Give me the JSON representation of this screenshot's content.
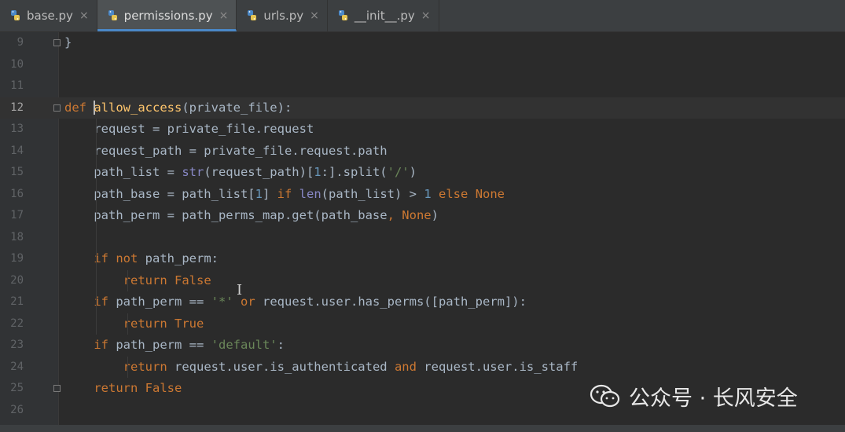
{
  "tabs": [
    {
      "label": "base.py",
      "icon": "python-file-icon",
      "active": false
    },
    {
      "label": "permissions.py",
      "icon": "python-file-icon",
      "active": true
    },
    {
      "label": "urls.py",
      "icon": "python-file-icon",
      "active": false
    },
    {
      "label": "__init__.py",
      "icon": "python-file-icon",
      "active": false
    }
  ],
  "tab_close_glyph": "×",
  "editor": {
    "lines": [
      {
        "n": "9",
        "text": "}"
      },
      {
        "n": "10",
        "text": ""
      },
      {
        "n": "11",
        "text": ""
      },
      {
        "n": "12",
        "text": "def allow_access(private_file):"
      },
      {
        "n": "13",
        "text": "    request = private_file.request"
      },
      {
        "n": "14",
        "text": "    request_path = private_file.request.path"
      },
      {
        "n": "15",
        "text": "    path_list = str(request_path)[1:].split('/')"
      },
      {
        "n": "16",
        "text": "    path_base = path_list[1] if len(path_list) > 1 else None"
      },
      {
        "n": "17",
        "text": "    path_perm = path_perms_map.get(path_base, None)"
      },
      {
        "n": "18",
        "text": ""
      },
      {
        "n": "19",
        "text": "    if not path_perm:"
      },
      {
        "n": "20",
        "text": "        return False"
      },
      {
        "n": "21",
        "text": "    if path_perm == '*' or request.user.has_perms([path_perm]):"
      },
      {
        "n": "22",
        "text": "        return True"
      },
      {
        "n": "23",
        "text": "    if path_perm == 'default':"
      },
      {
        "n": "24",
        "text": "        return request.user.is_authenticated and request.user.is_staff"
      },
      {
        "n": "25",
        "text": "    return False"
      },
      {
        "n": "26",
        "text": ""
      }
    ],
    "current_line": "12"
  },
  "watermark": {
    "text": "公众号 · 长风安全",
    "icon": "wechat-icon"
  },
  "colors": {
    "background": "#2b2b2b",
    "keyword": "#cc7832",
    "function": "#ffc66d",
    "builtin": "#8888c6",
    "number": "#6897bb",
    "string": "#6a8759",
    "text": "#a9b7c6",
    "active_tab_underline": "#4a88c7"
  }
}
